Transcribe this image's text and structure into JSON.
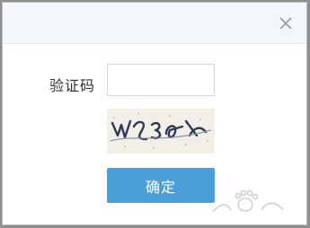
{
  "dialog": {
    "close_glyph": "×",
    "captcha_label": "验证码",
    "captcha_input": {
      "value": "",
      "placeholder": ""
    },
    "captcha_image": {
      "icon": "captcha-image"
    },
    "confirm_label": "确定"
  },
  "colors": {
    "button": "#4a9fd8",
    "titlebar": "#f3f7fc"
  }
}
